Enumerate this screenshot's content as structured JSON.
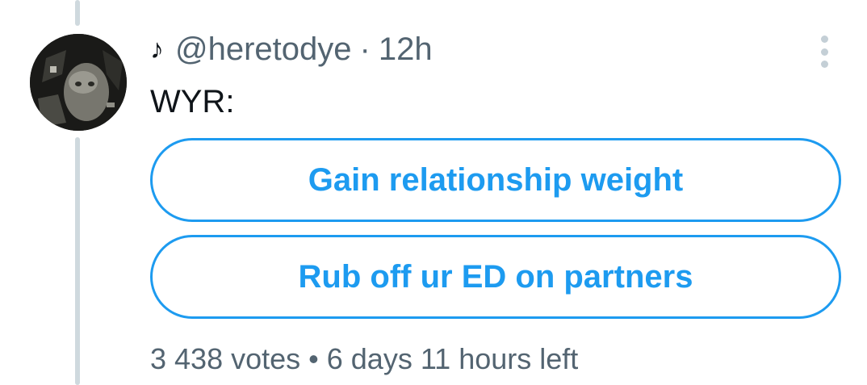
{
  "tweet": {
    "note_glyph": "♪",
    "handle": "@heretodye",
    "separator": "·",
    "time": "12h",
    "text": "WYR:"
  },
  "poll": {
    "options": [
      {
        "label": "Gain relationship weight"
      },
      {
        "label": "Rub off ur ED on partners"
      }
    ],
    "votes": "3 438 votes",
    "bullet": "•",
    "time_left": "6 days 11 hours left"
  },
  "colors": {
    "accent": "#1d9bf0",
    "secondary_text": "#536471",
    "thread_line": "#cfd9de"
  },
  "icons": {
    "more": "more-vertical-icon"
  }
}
